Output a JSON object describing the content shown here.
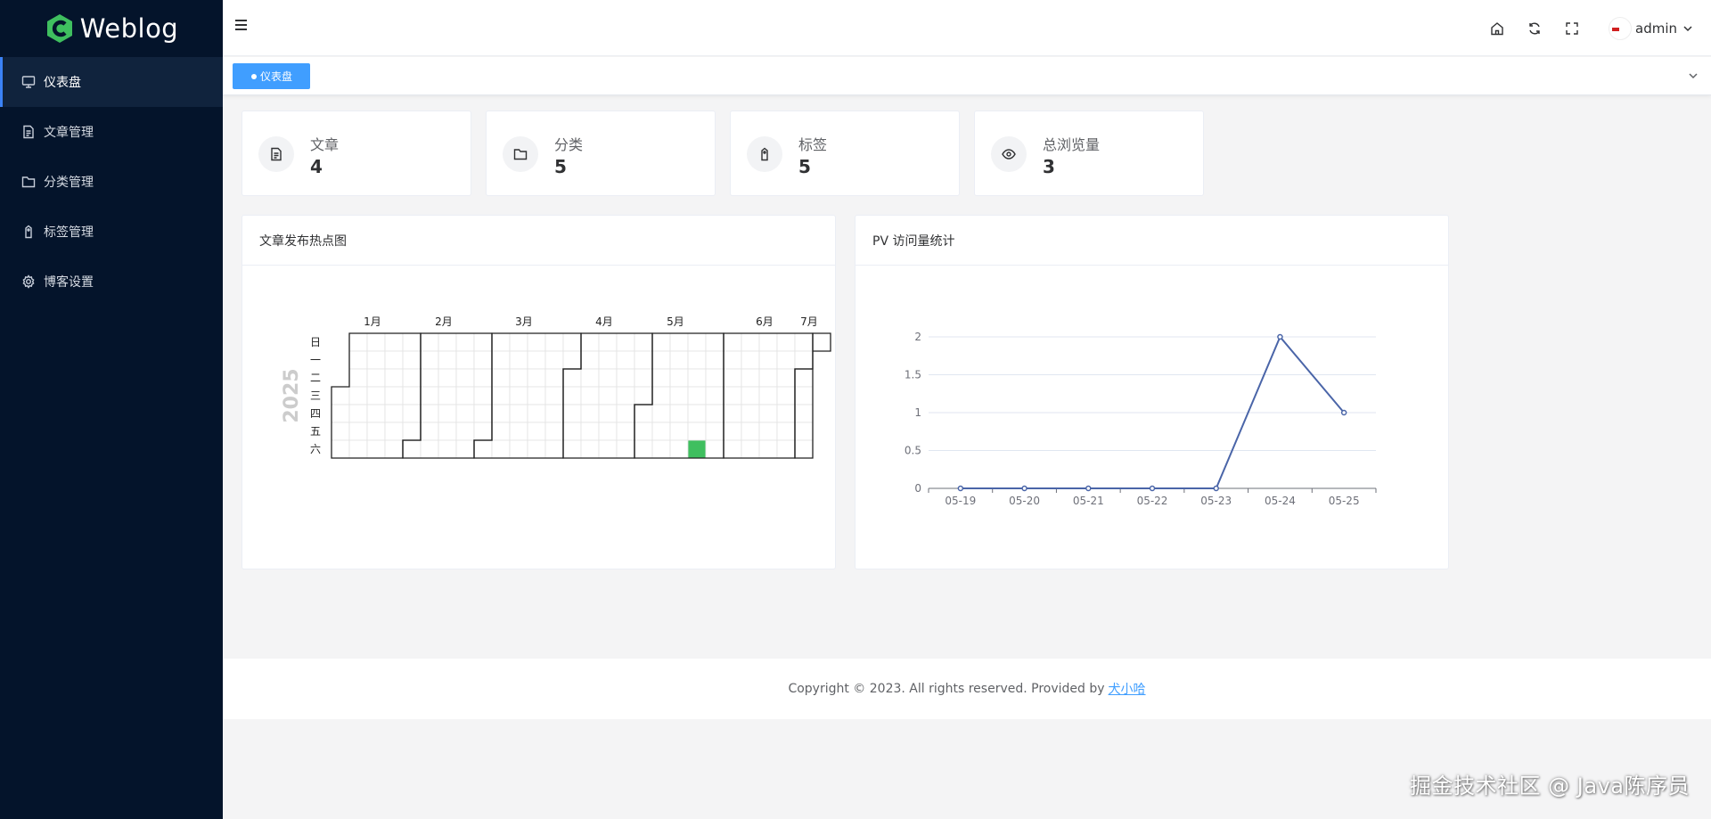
{
  "brand": {
    "logo_text": "Weblog",
    "accent": "#409eff",
    "sidebar_bg": "#04142b",
    "heat_color": "#3fbf5f",
    "line_color": "#4a65a8"
  },
  "sidebar": {
    "items": [
      {
        "label": "仪表盘",
        "icon": "monitor-icon",
        "active": true
      },
      {
        "label": "文章管理",
        "icon": "document-icon"
      },
      {
        "label": "分类管理",
        "icon": "folder-icon"
      },
      {
        "label": "标签管理",
        "icon": "tag-icon"
      },
      {
        "label": "博客设置",
        "icon": "gear-icon"
      }
    ]
  },
  "header": {
    "user_name": "admin"
  },
  "tabs": [
    {
      "label": "仪表盘",
      "active": true
    }
  ],
  "stats": [
    {
      "label": "文章",
      "value": "4",
      "icon": "document-icon"
    },
    {
      "label": "分类",
      "value": "5",
      "icon": "folder-icon"
    },
    {
      "label": "标签",
      "value": "5",
      "icon": "tag-icon"
    },
    {
      "label": "总浏览量",
      "value": "3",
      "icon": "eye-icon"
    }
  ],
  "heatmap_card": {
    "title": "文章发布热点图"
  },
  "pv_card": {
    "title": "PV 访问量统计"
  },
  "chart_data": [
    {
      "type": "heatmap",
      "title": "文章发布热点图",
      "year": "2025",
      "range": [
        "2025-01-01",
        "2025-07-06"
      ],
      "month_labels": [
        "1月",
        "2月",
        "3月",
        "4月",
        "5月",
        "6月",
        "7月"
      ],
      "weekday_labels": [
        "日",
        "一",
        "二",
        "三",
        "四",
        "五",
        "六"
      ],
      "highlighted": [
        {
          "date": "2025-05-24",
          "weekday": "六"
        }
      ]
    },
    {
      "type": "line",
      "title": "PV 访问量统计",
      "categories": [
        "05-19",
        "05-20",
        "05-21",
        "05-22",
        "05-23",
        "05-24",
        "05-25"
      ],
      "values": [
        0,
        0,
        0,
        0,
        0,
        2,
        1
      ],
      "ylim": [
        0,
        2
      ],
      "yticks": [
        "0",
        "0.5",
        "1",
        "1.5",
        "2"
      ],
      "grid": true
    }
  ],
  "footer": {
    "text": "Copyright © 2023. All rights reserved. Provided by",
    "link_text": "犬小哈"
  },
  "watermark": "掘金技术社区 @ Java陈序员"
}
